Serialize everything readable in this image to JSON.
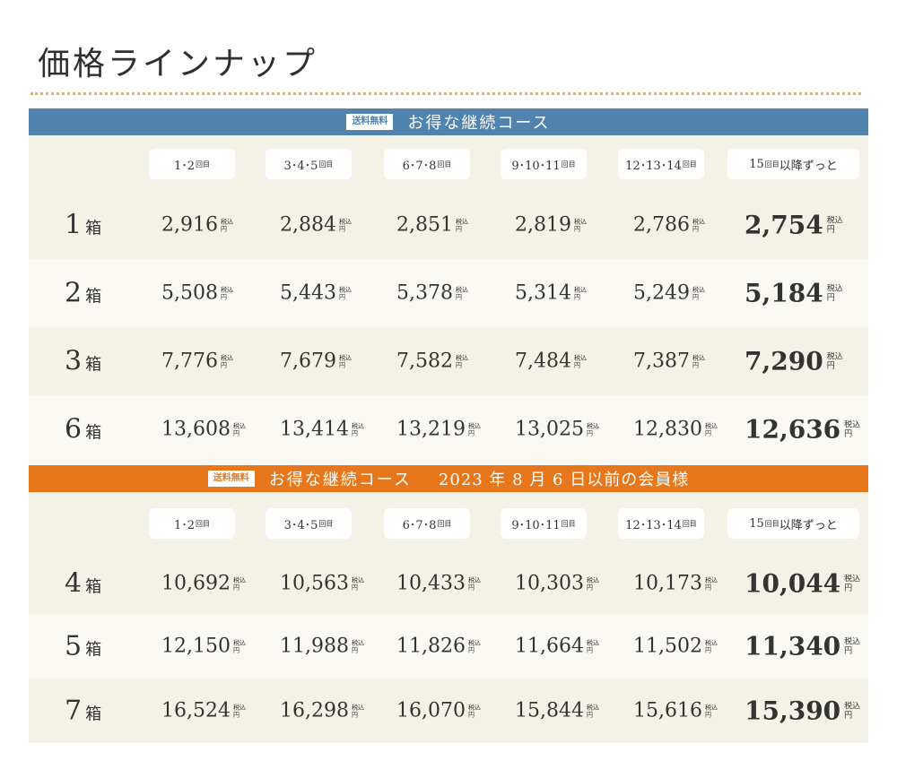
{
  "title": "価格ラインナップ",
  "colors": {
    "blue": "#5083ad",
    "orange": "#e8771c",
    "gold_dots": "#e3b53d",
    "row_light": "#f4f1e6",
    "row_lighter": "#faf8f3"
  },
  "tax_label": {
    "top": "税込",
    "bottom": "円"
  },
  "sections": [
    {
      "badge": "送料無料",
      "title": "お得な継続コース",
      "note": "",
      "tiers": [
        {
          "main": "1･2",
          "small": "回目"
        },
        {
          "main": "3･4･5",
          "small": "回目"
        },
        {
          "main": "6･7･8",
          "small": "回目"
        },
        {
          "main": "9･10･11",
          "small": "回目"
        },
        {
          "main": "12･13･14",
          "small": "回目"
        },
        {
          "main": "15",
          "small": "回目",
          "suffix": "以降ずっと"
        }
      ],
      "rows": [
        {
          "qty": "1",
          "unit": "箱",
          "prices": [
            "2,916",
            "2,884",
            "2,851",
            "2,819",
            "2,786",
            "2,754"
          ]
        },
        {
          "qty": "2",
          "unit": "箱",
          "prices": [
            "5,508",
            "5,443",
            "5,378",
            "5,314",
            "5,249",
            "5,184"
          ]
        },
        {
          "qty": "3",
          "unit": "箱",
          "prices": [
            "7,776",
            "7,679",
            "7,582",
            "7,484",
            "7,387",
            "7,290"
          ]
        },
        {
          "qty": "6",
          "unit": "箱",
          "prices": [
            "13,608",
            "13,414",
            "13,219",
            "13,025",
            "12,830",
            "12,636"
          ]
        }
      ]
    },
    {
      "badge": "送料無料",
      "title": "お得な継続コース",
      "note": "2023 年 8 月 6 日以前の会員様",
      "tiers": [
        {
          "main": "1･2",
          "small": "回目"
        },
        {
          "main": "3･4･5",
          "small": "回目"
        },
        {
          "main": "6･7･8",
          "small": "回目"
        },
        {
          "main": "9･10･11",
          "small": "回目"
        },
        {
          "main": "12･13･14",
          "small": "回目"
        },
        {
          "main": "15",
          "small": "回目",
          "suffix": "以降ずっと"
        }
      ],
      "rows": [
        {
          "qty": "4",
          "unit": "箱",
          "prices": [
            "10,692",
            "10,563",
            "10,433",
            "10,303",
            "10,173",
            "10,044"
          ]
        },
        {
          "qty": "5",
          "unit": "箱",
          "prices": [
            "12,150",
            "11,988",
            "11,826",
            "11,664",
            "11,502",
            "11,340"
          ]
        },
        {
          "qty": "7",
          "unit": "箱",
          "prices": [
            "16,524",
            "16,298",
            "16,070",
            "15,844",
            "15,616",
            "15,390"
          ]
        }
      ]
    }
  ]
}
